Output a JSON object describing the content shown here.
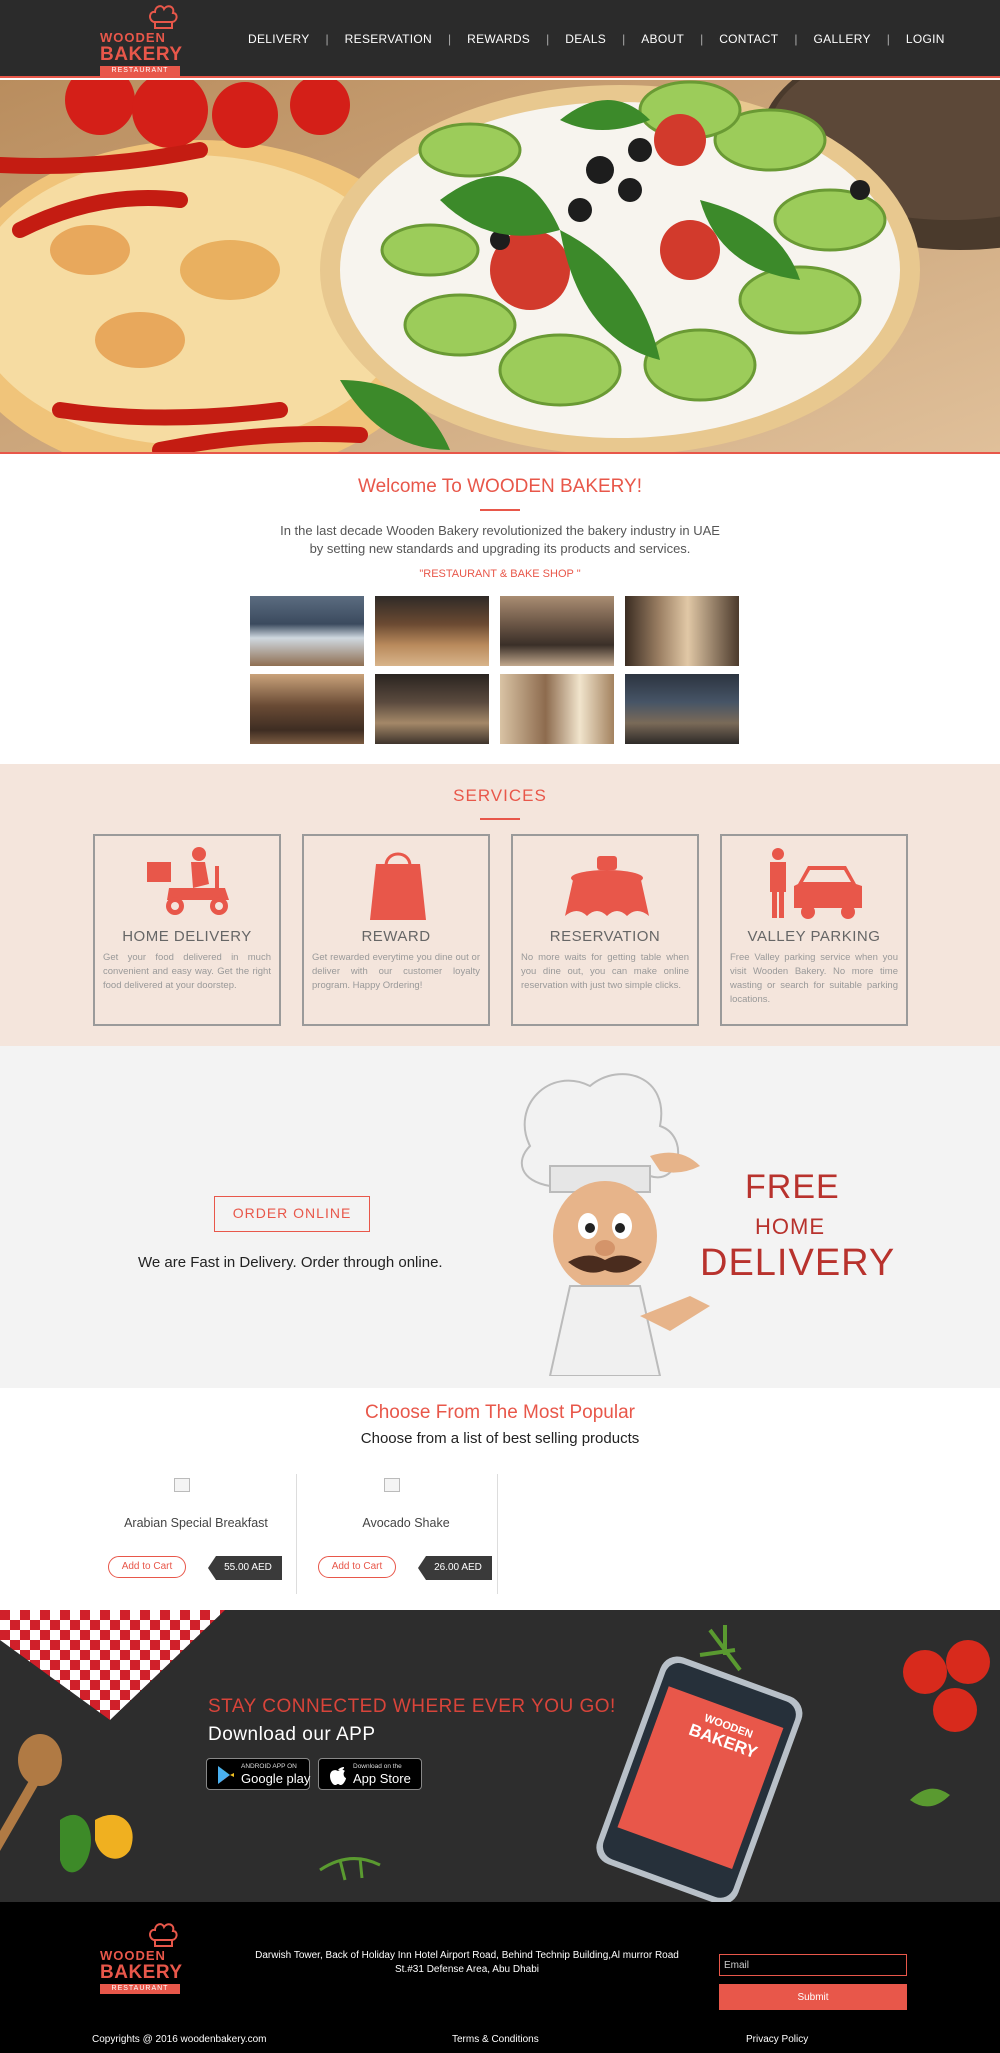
{
  "header": {
    "logo": {
      "line1": "WOODEN",
      "line2": "BAKERY",
      "line3": "RESTAURANT"
    },
    "nav": [
      "DELIVERY",
      "RESERVATION",
      "REWARDS",
      "DEALS",
      "ABOUT",
      "CONTACT",
      "GALLERY",
      "LOGIN"
    ]
  },
  "welcome": {
    "title": "Welcome To WOODEN BAKERY!",
    "line1": "In the last decade Wooden Bakery revolutionized the bakery industry in UAE",
    "line2": "by setting new standards and upgrading its products and services.",
    "tagline": "\"RESTAURANT & BAKE SHOP \""
  },
  "services": {
    "title": "SERVICES",
    "items": [
      {
        "name": "HOME DELIVERY",
        "icon": "scooter-icon",
        "desc": "Get your food delivered in much convenient and easy way. Get the right food delivered at your doorstep."
      },
      {
        "name": "REWARD",
        "icon": "shopping-bag-icon",
        "desc": "Get rewarded everytime you dine out or deliver with our customer loyalty program. Happy Ordering!"
      },
      {
        "name": "RESERVATION",
        "icon": "reserved-table-icon",
        "desc": "No more waits for getting table when you dine out, you can make online reservation with just two simple clicks."
      },
      {
        "name": "VALLEY PARKING",
        "icon": "valet-car-icon",
        "desc": "Free Valley parking service when you visit Wooden Bakery. No more time wasting or search for suitable parking locations."
      }
    ]
  },
  "order": {
    "button": "ORDER ONLINE",
    "text": "We are Fast in Delivery. Order through online.",
    "free": "FREE",
    "home": "HOME",
    "delivery": "DELIVERY"
  },
  "popular": {
    "title": "Choose From The Most Popular",
    "subtitle": "Choose from a list of best selling products",
    "products": [
      {
        "name": "Arabian Special Breakfast",
        "cart": "Add to Cart",
        "price": "55.00 AED"
      },
      {
        "name": "Avocado Shake",
        "cart": "Add to Cart",
        "price": "26.00 AED"
      }
    ]
  },
  "app": {
    "heading": "STAY CONNECTED WHERE EVER YOU GO!",
    "subheading": "Download our APP",
    "google": {
      "small": "ANDROID APP ON",
      "large": "Google play"
    },
    "apple": {
      "small": "Download on the",
      "large": "App Store"
    },
    "phone_logo": {
      "line1": "WOODEN",
      "line2": "BAKERY"
    }
  },
  "footer": {
    "logo": {
      "line1": "WOODEN",
      "line2": "BAKERY",
      "line3": "RESTAURANT"
    },
    "address1": "Darwish Tower, Back of Holiday Inn Hotel Airport Road, Behind Technip Building,Al murror Road",
    "address2": "St.#31 Defense Area, Abu Dhabi",
    "email_placeholder": "Email",
    "submit": "Submit",
    "copyright": "Copyrights @ 2016 woodenbakery.com",
    "terms": "Terms & Conditions",
    "privacy": "Privacy Policy"
  },
  "colors": {
    "accent": "#e8574a",
    "dark": "#2b2b2b",
    "services_bg": "#f4e5dc"
  }
}
